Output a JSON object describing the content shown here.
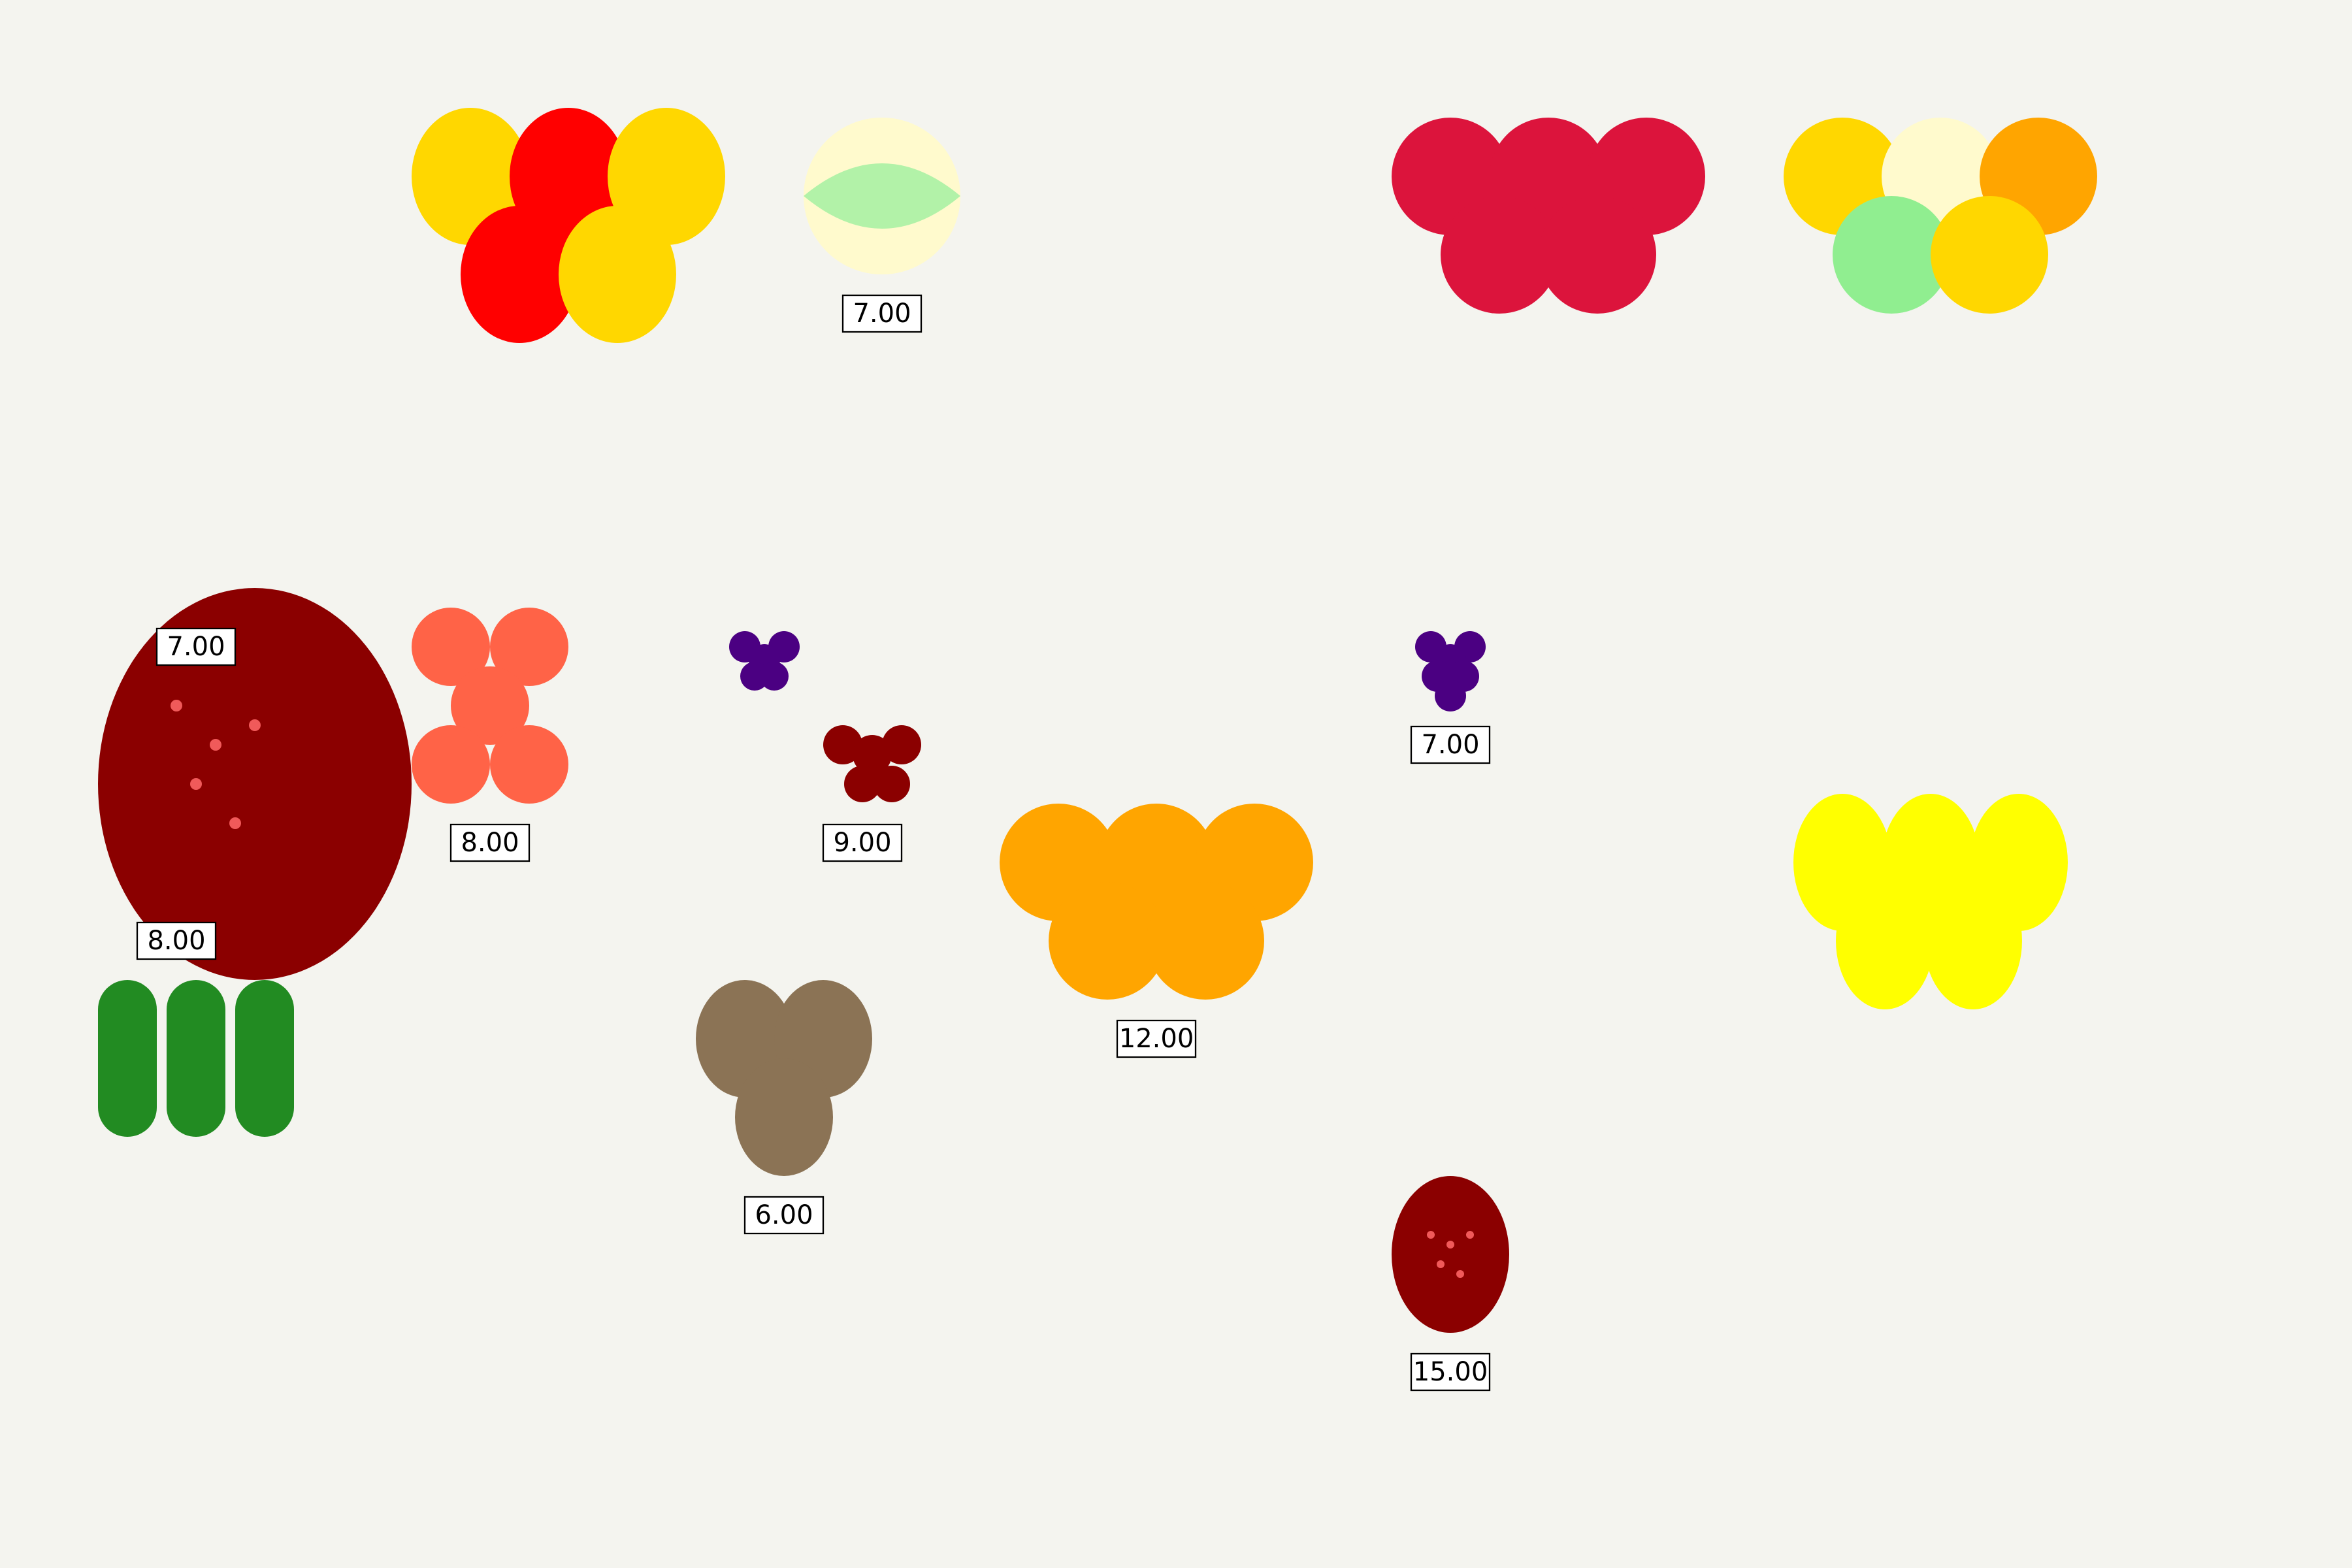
{
  "colors": {
    "background": "#f4f4ef",
    "gold": "#ffd700",
    "red": "#ff0000",
    "cream": "#fffacd",
    "light_green": "#b2f2a8",
    "crimson": "#dc143c",
    "orange": "#ffa500",
    "pale_green": "#90ee90",
    "dark_red": "#8b0000",
    "seed": "#f05a5a",
    "tomato": "#ff6347",
    "indigo": "#4b0082",
    "brown": "#8b7355",
    "forest_green": "#228b22",
    "yellow": "#ffff00"
  },
  "fruit_groups": [
    {
      "name": "fruit-cluster-gold-red"
    },
    {
      "name": "fruit-melon-slice",
      "price": "7.00"
    },
    {
      "name": "fruit-cluster-crimson"
    },
    {
      "name": "fruit-cluster-mixed"
    },
    {
      "name": "fruit-large-strawberry",
      "price_top": "7.00",
      "price_bottom": "8.00"
    },
    {
      "name": "fruit-cluster-tomato",
      "price": "8.00"
    },
    {
      "name": "fruit-grapes-small"
    },
    {
      "name": "fruit-cherries",
      "price": "9.00"
    },
    {
      "name": "fruit-grapes-purple",
      "price": "7.00"
    },
    {
      "name": "fruit-cluster-orange",
      "price": "12.00"
    },
    {
      "name": "fruit-cluster-yellow"
    },
    {
      "name": "fruit-cucumbers"
    },
    {
      "name": "fruit-potatoes",
      "price": "6.00"
    },
    {
      "name": "fruit-small-strawberry",
      "price": "15.00"
    }
  ]
}
